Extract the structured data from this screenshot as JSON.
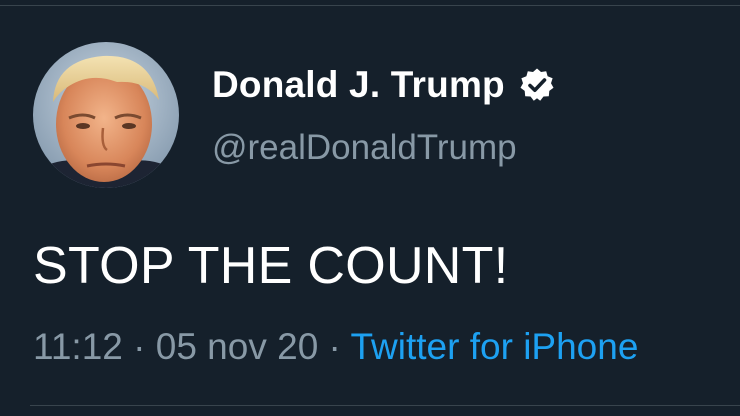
{
  "user": {
    "display_name": "Donald J. Trump",
    "handle": "@realDonaldTrump",
    "verified_icon": "verified-badge-icon",
    "avatar": "profile-photo"
  },
  "tweet": {
    "text": "STOP THE COUNT!",
    "time": "11:12",
    "separator": " · ",
    "date": "05 nov 20",
    "source": "Twitter for iPhone"
  },
  "colors": {
    "background": "#15202b",
    "primary_text": "#ffffff",
    "secondary_text": "#8899a6",
    "link": "#1da1f2"
  }
}
